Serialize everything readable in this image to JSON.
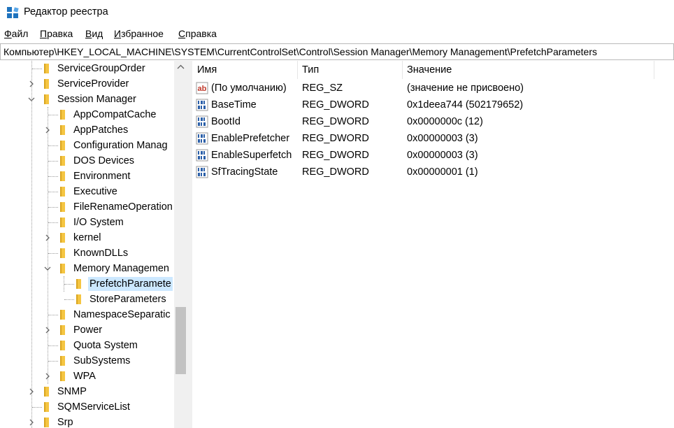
{
  "window": {
    "title": "Редактор реестра"
  },
  "menu": [
    {
      "label": "Файл",
      "underline": "Ф",
      "rest": "айл"
    },
    {
      "label": "Правка",
      "underline": "П",
      "rest": "равка"
    },
    {
      "label": "Вид",
      "underline": "В",
      "rest": "ид"
    },
    {
      "label": "Избранное",
      "underline": "И",
      "rest": "збранное"
    },
    {
      "label": "Справка",
      "underline": "С",
      "rest": "правка"
    }
  ],
  "address": "Компьютер\\HKEY_LOCAL_MACHINE\\SYSTEM\\CurrentControlSet\\Control\\Session Manager\\Memory Management\\PrefetchParameters",
  "tree": [
    {
      "label": "ServiceGroupOrder",
      "level": 1,
      "expander": "none"
    },
    {
      "label": "ServiceProvider",
      "level": 1,
      "expander": "collapsed"
    },
    {
      "label": "Session Manager",
      "level": 1,
      "expander": "expanded"
    },
    {
      "label": "AppCompatCache",
      "level": 2,
      "expander": "none"
    },
    {
      "label": "AppPatches",
      "level": 2,
      "expander": "collapsed"
    },
    {
      "label": "Configuration Manag",
      "level": 2,
      "expander": "none"
    },
    {
      "label": "DOS Devices",
      "level": 2,
      "expander": "none"
    },
    {
      "label": "Environment",
      "level": 2,
      "expander": "none"
    },
    {
      "label": "Executive",
      "level": 2,
      "expander": "none"
    },
    {
      "label": "FileRenameOperation",
      "level": 2,
      "expander": "none"
    },
    {
      "label": "I/O System",
      "level": 2,
      "expander": "none"
    },
    {
      "label": "kernel",
      "level": 2,
      "expander": "collapsed"
    },
    {
      "label": "KnownDLLs",
      "level": 2,
      "expander": "none"
    },
    {
      "label": "Memory Managemen",
      "level": 2,
      "expander": "expanded"
    },
    {
      "label": "PrefetchParamete",
      "level": 3,
      "expander": "none",
      "selected": true
    },
    {
      "label": "StoreParameters",
      "level": 3,
      "expander": "none"
    },
    {
      "label": "NamespaceSeparatic",
      "level": 2,
      "expander": "none"
    },
    {
      "label": "Power",
      "level": 2,
      "expander": "collapsed"
    },
    {
      "label": "Quota System",
      "level": 2,
      "expander": "none"
    },
    {
      "label": "SubSystems",
      "level": 2,
      "expander": "none"
    },
    {
      "label": "WPA",
      "level": 2,
      "expander": "collapsed"
    },
    {
      "label": "SNMP",
      "level": 1,
      "expander": "collapsed"
    },
    {
      "label": "SQMServiceList",
      "level": 1,
      "expander": "none"
    },
    {
      "label": "Srp",
      "level": 1,
      "expander": "collapsed"
    }
  ],
  "columns": {
    "name": "Имя",
    "type": "Тип",
    "data": "Значение"
  },
  "values": [
    {
      "name": "(По умолчанию)",
      "type": "REG_SZ",
      "data": "(значение не присвоено)",
      "icon": "string-value-icon"
    },
    {
      "name": "BaseTime",
      "type": "REG_DWORD",
      "data": "0x1deea744 (502179652)",
      "icon": "binary-value-icon"
    },
    {
      "name": "BootId",
      "type": "REG_DWORD",
      "data": "0x0000000c (12)",
      "icon": "binary-value-icon"
    },
    {
      "name": "EnablePrefetcher",
      "type": "REG_DWORD",
      "data": "0x00000003 (3)",
      "icon": "binary-value-icon"
    },
    {
      "name": "EnableSuperfetch",
      "type": "REG_DWORD",
      "data": "0x00000003 (3)",
      "icon": "binary-value-icon"
    },
    {
      "name": "SfTracingState",
      "type": "REG_DWORD",
      "data": "0x00000001 (1)",
      "icon": "binary-value-icon"
    }
  ],
  "colors": {
    "selection": "#cce8ff",
    "folder": "#f5c542",
    "string_icon": "#c0392b",
    "binary_icon": "#2b5fa8"
  }
}
